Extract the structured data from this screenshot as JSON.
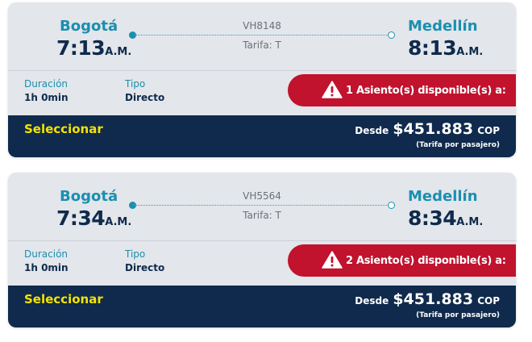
{
  "flights": [
    {
      "origin_city": "Bogotá",
      "origin_time": "7:13",
      "origin_ampm": "A.M.",
      "dest_city": "Medellín",
      "dest_time": "8:13",
      "dest_ampm": "A.M.",
      "flight_number": "VH8148",
      "fare": "Tarifa: T",
      "duration_label": "Duración",
      "duration_value": "1h 0min",
      "type_label": "Tipo",
      "type_value": "Directo",
      "seats_text": "1 Asiento(s) disponible(s) a:",
      "select_label": "Seleccionar",
      "price_prefix": "Desde",
      "price": "$451.883",
      "currency": "COP",
      "price_note": "(Tarifa por pasajero)"
    },
    {
      "origin_city": "Bogotá",
      "origin_time": "7:34",
      "origin_ampm": "A.M.",
      "dest_city": "Medellín",
      "dest_time": "8:34",
      "dest_ampm": "A.M.",
      "flight_number": "VH5564",
      "fare": "Tarifa: T",
      "duration_label": "Duración",
      "duration_value": "1h 0min",
      "type_label": "Tipo",
      "type_value": "Directo",
      "seats_text": "2 Asiento(s) disponible(s) a:",
      "select_label": "Seleccionar",
      "price_prefix": "Desde",
      "price": "$451.883",
      "currency": "COP",
      "price_note": "(Tarifa por pasajero)"
    }
  ],
  "colors": {
    "accent_teal": "#1a8fb0",
    "navy": "#0f2a4c",
    "alert_red": "#c1122e",
    "select_yellow": "#f5e400",
    "card_bg": "#e3e6ea"
  },
  "icons": {
    "seats_alert": "warning-triangle-icon"
  }
}
